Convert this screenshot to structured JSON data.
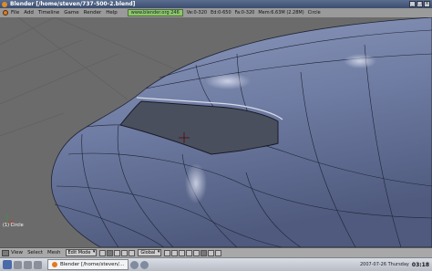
{
  "window": {
    "title": "Blender [/home/steven/737-500-2.blend]"
  },
  "menubar": {
    "items": [
      "File",
      "Add",
      "Timeline",
      "Game",
      "Render",
      "Help"
    ],
    "url": "www.blender.org 246",
    "stats": [
      "Ve:0-320",
      "Ed:0-650",
      "Fa:0-320",
      "Mem:6.63M (2.28M)",
      "Circle"
    ]
  },
  "viewport": {
    "object_name": "(1) Circle"
  },
  "header3d": {
    "items": [
      "View",
      "Select",
      "Mesh"
    ],
    "mode": "Edit Mode",
    "pivot": "Global"
  },
  "taskbar": {
    "task_label": "Blender [/home/steven/...",
    "date": "2007-07-26  Thursday",
    "time": "03:18"
  }
}
